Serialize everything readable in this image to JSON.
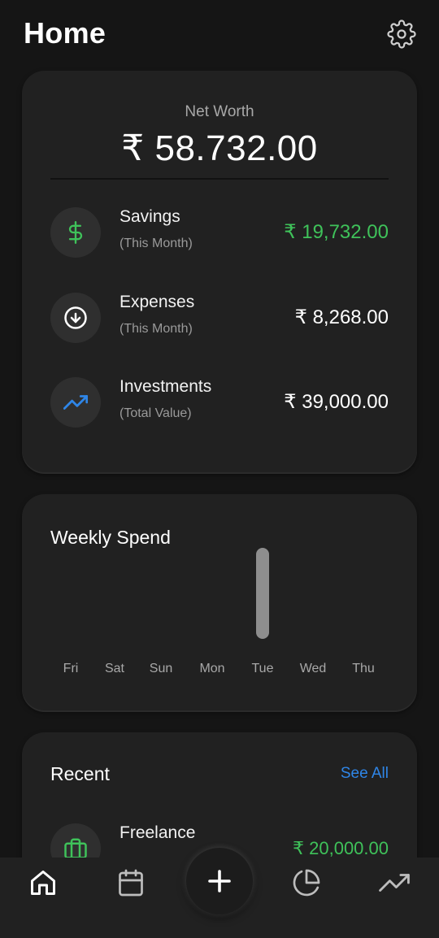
{
  "header": {
    "title": "Home",
    "settings_icon": "gear-icon"
  },
  "net_worth": {
    "label": "Net Worth",
    "value": "₹ 58.732.00",
    "rows": [
      {
        "label": "Savings",
        "sub": "(This Month)",
        "amount": "₹ 19,732.00",
        "icon": "dollar-icon",
        "amount_color": "#3fc25a"
      },
      {
        "label": "Expenses",
        "sub": "(This Month)",
        "amount": "₹ 8,268.00",
        "icon": "arrow-down-circle-icon",
        "amount_color": "#ffffff"
      },
      {
        "label": "Investments",
        "sub": "(Total Value)",
        "amount": "₹ 39,000.00",
        "icon": "trending-up-icon",
        "amount_color": "#ffffff"
      }
    ]
  },
  "weekly_spend": {
    "title": "Weekly Spend",
    "chart_data": {
      "type": "bar",
      "categories": [
        "Fri",
        "Sat",
        "Sun",
        "Mon",
        "Tue",
        "Wed",
        "Thu"
      ],
      "values": [
        0,
        0,
        0,
        0,
        1,
        0,
        0
      ]
    }
  },
  "recent": {
    "title": "Recent",
    "see_all": "See All",
    "items": [
      {
        "name": "Freelance",
        "amount": "₹ 20,000.00",
        "icon": "briefcase-icon"
      }
    ]
  },
  "bottom_nav": {
    "items": [
      "home-icon",
      "calendar-icon",
      "plus-icon",
      "pie-chart-icon",
      "trending-up-icon"
    ]
  },
  "colors": {
    "accent_green": "#3fc25a",
    "accent_blue": "#2f86e8",
    "background": "#151515",
    "card": "#212121"
  }
}
